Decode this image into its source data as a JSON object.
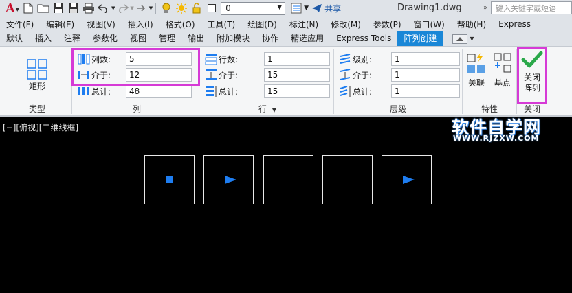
{
  "app": {
    "logo_letter": "A",
    "layer_value": "0",
    "share_label": "共享",
    "document_title": "Drawing1.dwg",
    "search_placeholder": "键入关键字或短语"
  },
  "menu": [
    "文件(F)",
    "编辑(E)",
    "视图(V)",
    "插入(I)",
    "格式(O)",
    "工具(T)",
    "绘图(D)",
    "标注(N)",
    "修改(M)",
    "参数(P)",
    "窗口(W)",
    "帮助(H)",
    "Express"
  ],
  "ribbon_tabs": [
    "默认",
    "插入",
    "注释",
    "参数化",
    "视图",
    "管理",
    "输出",
    "附加模块",
    "协作",
    "精选应用",
    "Express Tools",
    "阵列创建"
  ],
  "active_tab": "阵列创建",
  "panels": {
    "type": {
      "title": "类型",
      "button": "矩形"
    },
    "columns": {
      "title": "列",
      "count_label": "列数:",
      "count_value": "5",
      "spacing_label": "介于:",
      "spacing_value": "12",
      "total_label": "总计:",
      "total_value": "48"
    },
    "rows": {
      "title": "行",
      "count_label": "行数:",
      "count_value": "1",
      "spacing_label": "介于:",
      "spacing_value": "15",
      "total_label": "总计:",
      "total_value": "15"
    },
    "levels": {
      "title": "层级",
      "count_label": "级别:",
      "count_value": "1",
      "spacing_label": "介于:",
      "spacing_value": "1",
      "total_label": "总计:",
      "total_value": "1"
    },
    "properties": {
      "title": "特性",
      "associative": "关联",
      "basepoint": "基点"
    },
    "close": {
      "title": "关闭",
      "button_line1": "关闭",
      "button_line2": "阵列"
    }
  },
  "viewport": {
    "label": "[−][俯视][二维线框]",
    "cells": [
      {
        "mark": "square"
      },
      {
        "mark": "triangle"
      },
      {
        "mark": "none"
      },
      {
        "mark": "none"
      },
      {
        "mark": "triangle"
      }
    ]
  },
  "watermark": {
    "main": "软件自学网",
    "sub": "WWW.RJZXW.COM"
  },
  "colors": {
    "accent": "#1a87d7",
    "highlight": "#d63ad6",
    "mark": "#1e7df0",
    "checkmark": "#2aa84a"
  }
}
